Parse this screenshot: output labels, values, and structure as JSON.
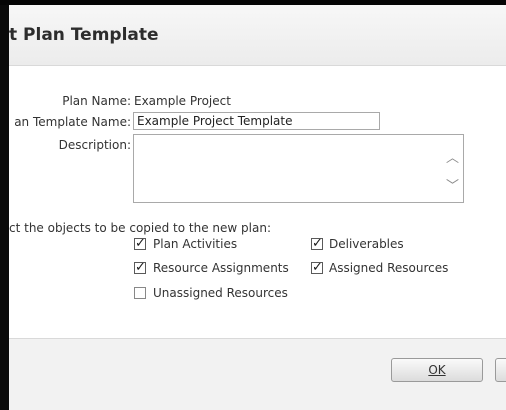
{
  "dialog": {
    "title": "t Plan Template"
  },
  "form": {
    "plan_name_label": "Plan Name:",
    "plan_name_value": "Example Project",
    "template_name_label": "an Template Name:",
    "template_name_value": "Example Project Template",
    "description_label": "Description:",
    "description_value": ""
  },
  "objects": {
    "prompt": "ct the objects to be copied to the new plan:",
    "items": [
      {
        "label": "Plan Activities",
        "checked": true
      },
      {
        "label": "Deliverables",
        "checked": true
      },
      {
        "label": "Resource Assignments",
        "checked": true
      },
      {
        "label": "Assigned Resources",
        "checked": true
      },
      {
        "label": "Unassigned Resources",
        "checked": false
      }
    ]
  },
  "buttons": {
    "ok_label": "OK"
  }
}
